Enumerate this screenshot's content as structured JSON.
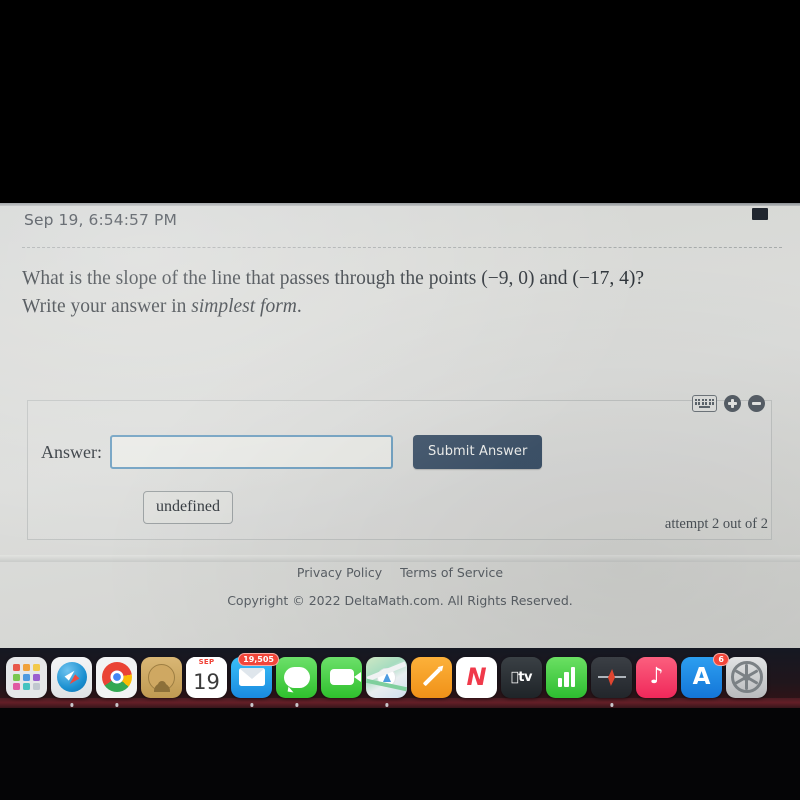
{
  "timestamp": "Sep 19, 6:54:57 PM",
  "question": {
    "line1_a": "What is the slope of the line that passes through the points ",
    "point1": "(−9, 0)",
    "line1_b": " and ",
    "point2": "(−17, 4)",
    "line1_c": "?",
    "line2_a": "Write your answer in ",
    "line2_italic": "simplest form",
    "line2_b": "."
  },
  "answer_panel": {
    "label": "Answer:",
    "input_value": "",
    "input_placeholder": "",
    "submit_label": "Submit Answer",
    "undefined_label": "undefined",
    "attempt_text": "attempt 2 out of 2",
    "tools": {
      "keyboard_icon": "keyboard-icon",
      "zoom_in_icon": "plus-circle-icon",
      "zoom_out_icon": "minus-circle-icon"
    },
    "input_border_color": "#6c9ec0",
    "submit_bg_color": "#3e536a"
  },
  "footer": {
    "privacy_policy": "Privacy Policy",
    "terms_of_service": "Terms of Service",
    "copyright": "Copyright © 2022 DeltaMath.com. All Rights Reserved."
  },
  "dock": {
    "items": [
      {
        "name": "launchpad",
        "label": "Launchpad",
        "running": false,
        "badge": ""
      },
      {
        "name": "safari",
        "label": "Safari",
        "running": true,
        "badge": ""
      },
      {
        "name": "chrome",
        "label": "Google Chrome",
        "running": true,
        "badge": ""
      },
      {
        "name": "contacts",
        "label": "Contacts",
        "running": false,
        "badge": ""
      },
      {
        "name": "calendar",
        "label": "Calendar",
        "running": false,
        "badge": "",
        "month": "SEP",
        "day": "19"
      },
      {
        "name": "mail",
        "label": "Mail",
        "running": true,
        "badge": "19,505"
      },
      {
        "name": "messages",
        "label": "Messages",
        "running": true,
        "badge": ""
      },
      {
        "name": "facetime",
        "label": "FaceTime",
        "running": false,
        "badge": ""
      },
      {
        "name": "maps",
        "label": "Maps",
        "running": true,
        "badge": ""
      },
      {
        "name": "notes",
        "label": "Notes",
        "running": false,
        "badge": ""
      },
      {
        "name": "news",
        "label": "News",
        "running": false,
        "badge": ""
      },
      {
        "name": "apple-tv",
        "label": "TV",
        "running": false,
        "badge": "",
        "text": "tv"
      },
      {
        "name": "numbers",
        "label": "Numbers",
        "running": false,
        "badge": ""
      },
      {
        "name": "garageband",
        "label": "GarageBand",
        "running": true,
        "badge": ""
      },
      {
        "name": "music",
        "label": "Music",
        "running": false,
        "badge": ""
      },
      {
        "name": "app-store",
        "label": "App Store",
        "running": false,
        "badge": "6"
      },
      {
        "name": "system-preferences",
        "label": "System Preferences",
        "running": false,
        "badge": ""
      }
    ]
  }
}
